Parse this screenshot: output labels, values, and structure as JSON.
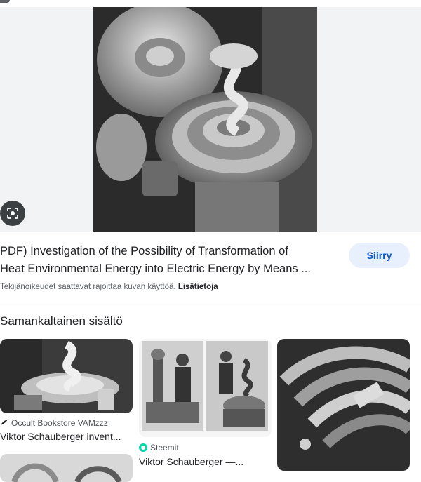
{
  "hero": {
    "image_alt": "Vortex spiral machine photo",
    "lens_icon": "google-lens-icon"
  },
  "result": {
    "title_line1": "PDF) Investigation of the Possibility of Transformation of",
    "title_line2": "Heat Environmental Energy into Electric Energy by Means ...",
    "visit_label": "Siirry",
    "rights_text": "Tekijänoikeudet saattavat rajoittaa kuvan käyttöä.",
    "learn_more": "Lisätietoja"
  },
  "related": {
    "heading": "Samankaltainen sisältö",
    "cards": [
      {
        "source": "Occult Bookstore VAMzzz",
        "source_icon": "bird-icon",
        "caption": "Viktor Schauberger invent..."
      },
      {
        "source": "Steemit",
        "source_icon": "steemit-icon",
        "caption": "Viktor Schauberger —..."
      },
      {
        "source": "",
        "caption": ""
      }
    ]
  },
  "colors": {
    "accent": "#0b57d0",
    "button_bg": "#e8f0fe",
    "text": "#202124",
    "muted": "#5f6368"
  }
}
